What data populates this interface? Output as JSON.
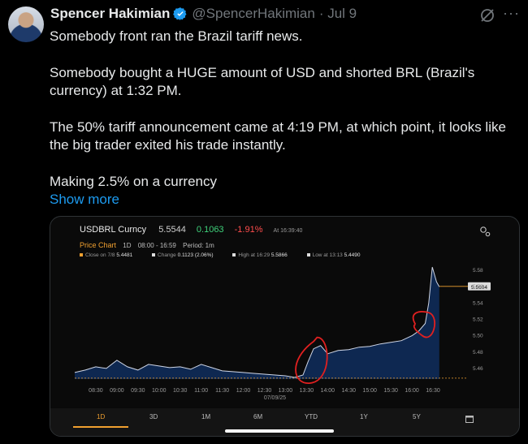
{
  "tweet": {
    "author_name": "Spencer Hakimian",
    "handle": "@SpencerHakimian",
    "date": "· Jul 9",
    "lines": [
      "Somebody front ran the Brazil tariff news.",
      "Somebody bought a HUGE amount of USD and shorted BRL (Brazil's currency) at 1:32 PM.",
      "The 50% tariff announcement came at 4:19 PM, at which point, it looks like the big trader exited his trade instantly.",
      "Making 2.5% on a currency"
    ],
    "show_more": "Show more",
    "more_icon": "···"
  },
  "card": {
    "symbol": "USDBRL Curncy",
    "price": "5.5544",
    "change": "0.1063",
    "change_pct": "-1.91%",
    "at_time": "At 16:39:40",
    "price_chart": {
      "label": "Price Chart",
      "span": "1D",
      "hours": "08:00 - 16:59",
      "period": "Period: 1m"
    },
    "stats": {
      "close_label": "Close on 7/8",
      "close_value": "5.4481",
      "change_label": "Change",
      "change_value": "0.1123 (2.06%)",
      "high_label": "High at 16:29",
      "high_value": "5.5866",
      "low_label": "Low at 13:13",
      "low_value": "5.4490"
    },
    "tabs": [
      "1D",
      "3D",
      "1M",
      "6M",
      "YTD",
      "1Y",
      "5Y"
    ],
    "active_tab": "1D",
    "colors": {
      "accent": "#f0a030",
      "up": "#3fd27b",
      "down": "#ff4d4d",
      "area": "#0f2a55",
      "line": "#cfd6e6",
      "annotation": "#e02020"
    }
  },
  "chart_data": {
    "type": "area",
    "title": "USDBRL Curncy",
    "x_ticks": [
      "08:30",
      "09:00",
      "09:30",
      "10:00",
      "10:30",
      "11:00",
      "11:30",
      "12:00",
      "12:30",
      "13:00",
      "13:30",
      "14:00",
      "14:30",
      "15:00",
      "15:30",
      "16:00",
      "16:30"
    ],
    "x_date_label": "07/09/25",
    "y_ticks": [
      "5.58",
      "5.56",
      "5.54",
      "5.52",
      "5.50",
      "5.48",
      "5.46"
    ],
    "ylim": [
      5.447,
      5.588
    ],
    "last_price_label": "5.5604",
    "reference_line": 5.4481,
    "series": [
      {
        "x": [
          "08:00",
          "08:15",
          "08:30",
          "08:45",
          "09:00",
          "09:15",
          "09:30",
          "09:45",
          "10:00",
          "10:15",
          "10:30",
          "10:45",
          "11:00",
          "11:15",
          "11:30",
          "11:45",
          "12:00",
          "12:15",
          "12:30",
          "12:45",
          "13:00",
          "13:13",
          "13:25",
          "13:32",
          "13:40",
          "13:50",
          "14:00",
          "14:15",
          "14:30",
          "14:45",
          "15:00",
          "15:15",
          "15:30",
          "15:45",
          "16:00",
          "16:10",
          "16:19",
          "16:24",
          "16:29",
          "16:35",
          "16:39"
        ],
        "values": [
          5.455,
          5.458,
          5.462,
          5.46,
          5.47,
          5.462,
          5.458,
          5.465,
          5.463,
          5.461,
          5.462,
          5.459,
          5.465,
          5.461,
          5.457,
          5.456,
          5.455,
          5.454,
          5.453,
          5.452,
          5.451,
          5.449,
          5.452,
          5.468,
          5.484,
          5.488,
          5.478,
          5.482,
          5.483,
          5.486,
          5.487,
          5.49,
          5.492,
          5.494,
          5.5,
          5.506,
          5.515,
          5.54,
          5.584,
          5.566,
          5.56
        ]
      }
    ],
    "grid": false
  }
}
